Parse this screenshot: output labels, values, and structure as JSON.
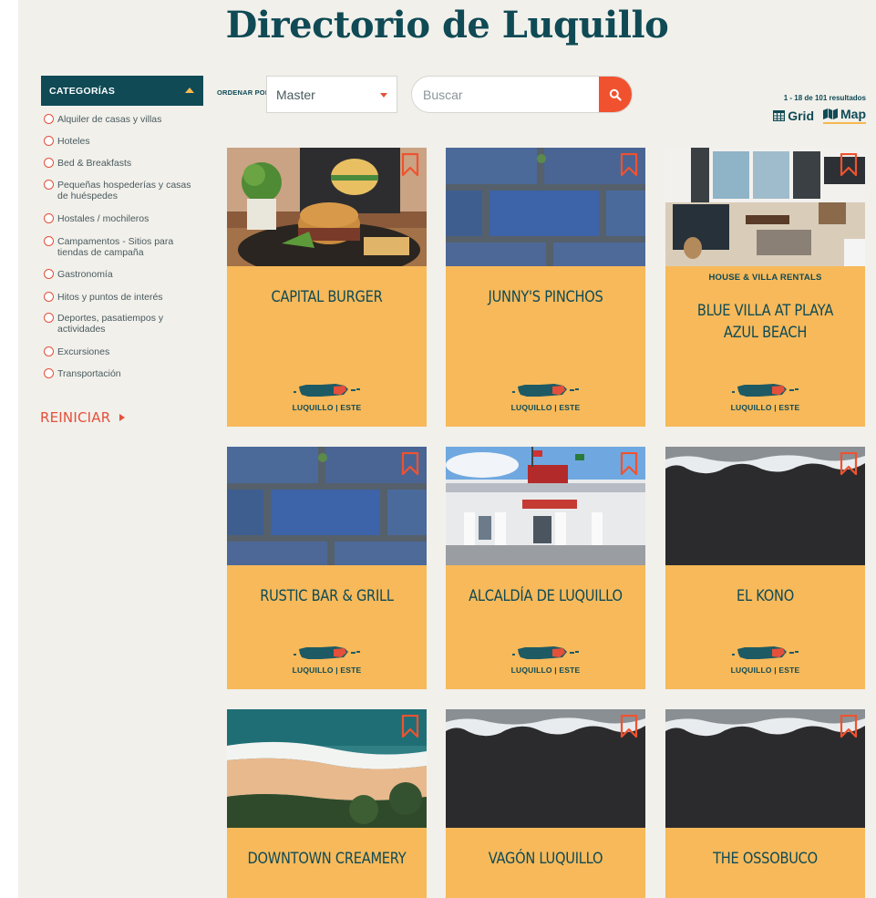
{
  "page": {
    "title": "Directorio de Luquillo"
  },
  "sidebar": {
    "header": "CATEGORÍAS",
    "categories": [
      "Alquiler de casas y villas",
      "Hoteles",
      "Bed & Breakfasts",
      "Pequeñas hospederías y casas de huéspedes",
      "Hostales / mochileros",
      "Campamentos - Sitios para tiendas de campaña",
      "Gastronomía",
      "Hitos y puntos de interés",
      "Deportes, pasatiempos y actividades",
      "Excursiones",
      "Transportación"
    ],
    "reset_label": "REINICIAR"
  },
  "toolbar": {
    "sort_label": "ORDENAR POR",
    "sort_value": "Master",
    "search_placeholder": "Buscar",
    "results_text": "1 - 18 de 101 resultados",
    "grid_label": "Grid",
    "map_label": "Map"
  },
  "colors": {
    "teal": "#0f4a55",
    "orange": "#f0522f",
    "card": "#f7b95a",
    "accent": "#e4503a"
  },
  "cards": [
    {
      "name": "CAPITAL BURGER",
      "subtitle": "",
      "location": "LUQUILLO | ESTE",
      "image": "burger"
    },
    {
      "name": "JUNNY'S PINCHOS",
      "subtitle": "",
      "location": "LUQUILLO | ESTE",
      "image": "blue-bricks"
    },
    {
      "name": "BLUE VILLA AT PLAYA AZUL BEACH",
      "subtitle": "HOUSE & VILLA RENTALS",
      "location": "LUQUILLO | ESTE",
      "image": "living-room"
    },
    {
      "name": "RUSTIC BAR & GRILL",
      "subtitle": "",
      "location": "LUQUILLO | ESTE",
      "image": "blue-bricks"
    },
    {
      "name": "ALCALDÍA DE LUQUILLO",
      "subtitle": "",
      "location": "LUQUILLO | ESTE",
      "image": "city-hall"
    },
    {
      "name": "EL KONO",
      "subtitle": "",
      "location": "LUQUILLO | ESTE",
      "image": "black-sand"
    },
    {
      "name": "DOWNTOWN CREAMERY",
      "subtitle": "",
      "location": "",
      "image": "beach-aerial"
    },
    {
      "name": "VAGÓN LUQUILLO",
      "subtitle": "",
      "location": "",
      "image": "black-sand"
    },
    {
      "name": "THE OSSOBUCO",
      "subtitle": "",
      "location": "",
      "image": "black-sand"
    }
  ]
}
